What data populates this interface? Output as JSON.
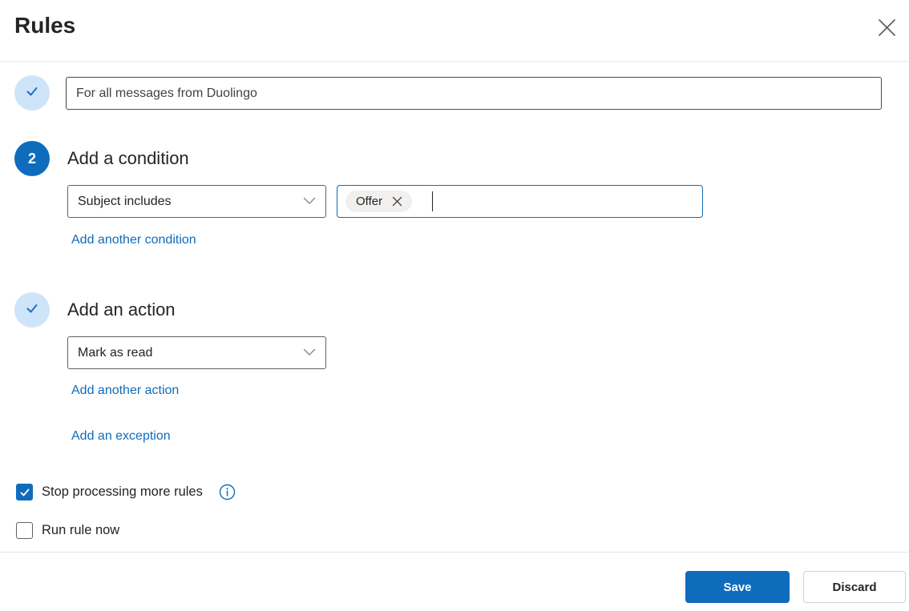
{
  "dialog": {
    "title": "Rules"
  },
  "colors": {
    "primary_blue": "#0f6cbd",
    "step_done_circle_bg": "#cee4f9",
    "link_blue": "#0f6cbd",
    "text_dark": "#242424",
    "chip_bg": "#f1f0ef"
  },
  "steps": {
    "name": {
      "value": "For all messages from Duolingo",
      "status": "complete"
    },
    "condition": {
      "number": "2",
      "heading": "Add a condition",
      "dropdown_value": "Subject includes",
      "chip_value": "Offer",
      "add_link": "Add another condition"
    },
    "action": {
      "heading": "Add an action",
      "dropdown_value": "Mark as read",
      "status": "complete",
      "add_link": "Add another action",
      "exception_link": "Add an exception"
    }
  },
  "options": {
    "stop_processing": {
      "label": "Stop processing more rules",
      "checked": true
    },
    "run_now": {
      "label": "Run rule now",
      "checked": false
    }
  },
  "footer": {
    "save_label": "Save",
    "discard_label": "Discard"
  }
}
